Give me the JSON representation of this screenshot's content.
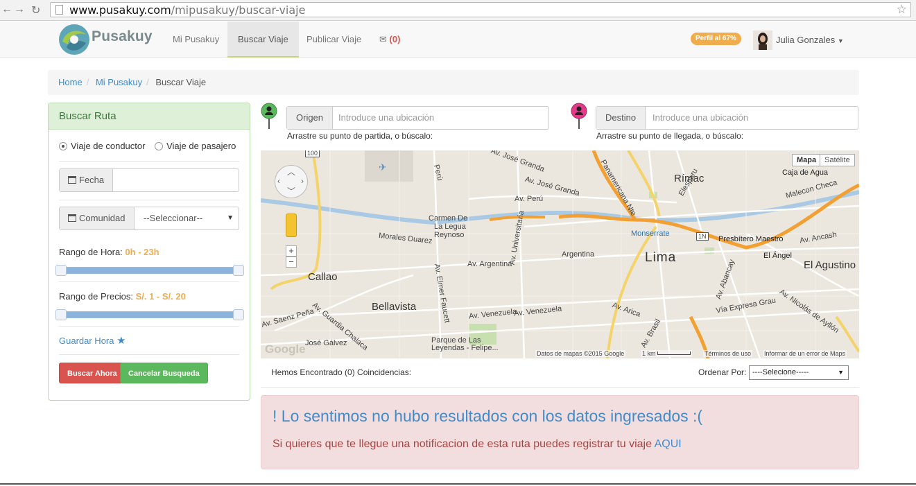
{
  "browser": {
    "url_host": "www.pusakuy.com",
    "url_path": "/mipusakuy/buscar-viaje"
  },
  "nav": {
    "brand": "Pusakuy",
    "links": [
      "Mi Pusakuy",
      "Buscar Viaje",
      "Publicar Viaje"
    ],
    "messages_count": "(0)",
    "profile_badge": "Perfil al 67%",
    "user_name": "Julia Gonzales"
  },
  "breadcrumb": {
    "home": "Home",
    "mi": "Mi Pusakuy",
    "current": "Buscar Viaje"
  },
  "search": {
    "title": "Buscar Ruta",
    "radio_conductor": "Viaje de conductor",
    "radio_pasajero": "Viaje de pasajero",
    "selected_radio": "Viaje de conductor",
    "fecha_label": "Fecha",
    "fecha_value": "",
    "comunidad_label": "Comunidad",
    "comunidad_value": "--Seleccionar--",
    "hora_label": "Rango de Hora: ",
    "hora_value": "0h - 23h",
    "hora_range": [
      0,
      23
    ],
    "precio_label": "Rango de Precios: ",
    "precio_value": "S/. 1 - S/. 20",
    "precio_range": [
      1,
      20
    ],
    "guardar": "Guardar Hora",
    "buscar_btn": "Buscar Ahora",
    "cancelar_btn": "Cancelar Busqueda"
  },
  "origin": {
    "label": "Origen",
    "placeholder": "Introduce una ubicación",
    "hint": "Arrastre su punto de partida, o búscalo:",
    "pin_color": "#5cb85c"
  },
  "destination": {
    "label": "Destino",
    "placeholder": "Introduce una ubicación",
    "hint": "Arrastre su punto de llegada, o búscalo:",
    "pin_color": "#e23b8a"
  },
  "map": {
    "type_map": "Mapa",
    "type_sat": "Satélite",
    "labels": {
      "callao": "Callao",
      "lima": "Lima",
      "rimac": "Rímac",
      "carmen": "Carmen De\nLa Legua\nReynoso",
      "bellavista": "Bellavista",
      "agustino": "El Agustino",
      "monserrate": "Monserrate",
      "presbitero": "Presbítero Maestro",
      "angel": "El Ángel",
      "caja": "Caja de Agua",
      "parque": "Parque de Las\nLeyendas - Felipe...",
      "av_argentina": "Av. Argentina",
      "av_argentina2": "Argentina",
      "av_venezuela": "Av. Venezuela",
      "av_peru": "Av. Perú",
      "av_jose_granda": "Av. José Granda",
      "morales": "Morales Duarez",
      "panamericana": "Panamericana Nte",
      "av_arica": "Av. Arica",
      "via_grau": "Vía Expresa Grau",
      "av_ancash": "Av. Ancash",
      "malecon": "Malecon Checa",
      "elespuru": "Elespuru",
      "av_universitaria": "Av. Universitaria",
      "av_elmer": "Av. Elmer Faucett",
      "av_chalaca": "Av. Guardia Chalaca",
      "av_saenz": "Av. Saenz Peña",
      "jose_galvez": "José Gálvez",
      "av_brasil": "Av. Brasil",
      "av_abancay": "Av. Abancay",
      "av_nicolas": "Av. Nicolás de Ayllón",
      "peru": "Perú",
      "av_carretera": "1N",
      "shield": "100"
    },
    "attribution": "Datos de mapas ©2015 Google",
    "scale": "1 km",
    "terms": "Términos de uso",
    "report": "Informar de un error de Maps",
    "google": "Google"
  },
  "results": {
    "found": "Hemos Encontrado (0) Coincidencias:",
    "order_label": "Ordenar Por:",
    "order_value": "----Selecione-----"
  },
  "alert": {
    "title": "! Lo sentimos no hubo resultados con los datos ingresados :(",
    "text": "Si quieres que te llegue una notificacion de esta ruta puedes registrar tu viaje ",
    "link": "AQUI"
  },
  "colors": {
    "primary": "#428bca",
    "warning": "#f0ad4e",
    "danger": "#d9534f",
    "success": "#5cb85c"
  }
}
